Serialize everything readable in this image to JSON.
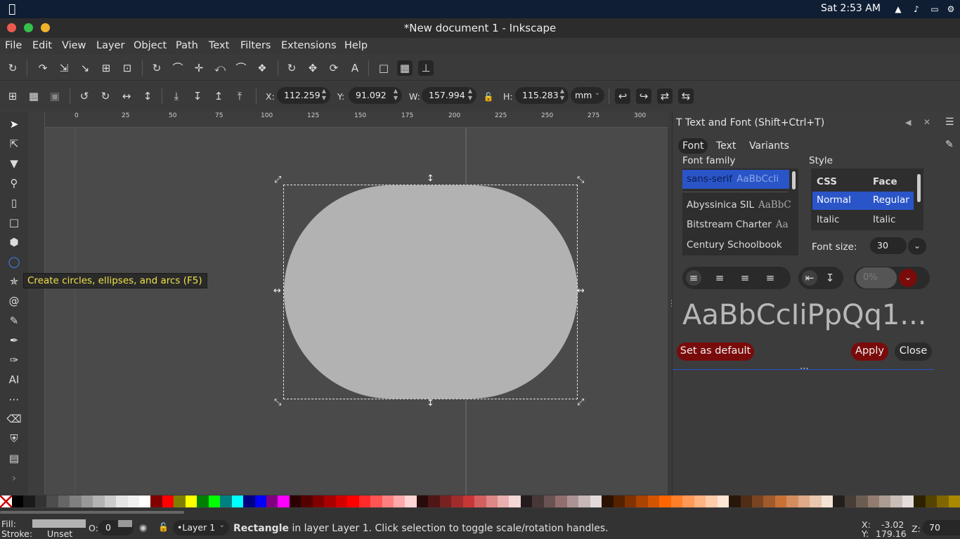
{
  "system": {
    "clock": "Sat  2:53 AM"
  },
  "window": {
    "title": "*New document 1 - Inkscape"
  },
  "menu": [
    "File",
    "Edit",
    "View",
    "Layer",
    "Object",
    "Path",
    "Text",
    "Filters",
    "Extensions",
    "Help"
  ],
  "controls": {
    "x_label": "X:",
    "x_value": "112.259",
    "y_label": "Y:",
    "y_value": "91.092",
    "w_label": "W:",
    "w_value": "157.994",
    "h_label": "H:",
    "h_value": "115.283",
    "unit": "mm"
  },
  "ruler": {
    "h_ticks": [
      "0",
      "25",
      "50",
      "75",
      "100",
      "125",
      "150",
      "175",
      "200",
      "225",
      "250",
      "275",
      "300"
    ]
  },
  "tooltip": "Create circles, ellipses, and arcs (F5)",
  "panel": {
    "title": "Text and Font (Shift+Ctrl+T)",
    "tabs": [
      "Font",
      "Text",
      "Variants"
    ],
    "font_family_label": "Font family",
    "style_label": "Style",
    "fonts": [
      {
        "name": "sans-serif",
        "preview": "AaBbCcIi"
      },
      {
        "name": "Abyssinica SIL",
        "preview": "AaBbC"
      },
      {
        "name": "Bitstream Charter",
        "preview": "Aa"
      },
      {
        "name": "Century Schoolbook",
        "preview": ""
      }
    ],
    "style_headers": {
      "css": "CSS",
      "face": "Face"
    },
    "styles": [
      {
        "css": "Normal",
        "face": "Regular"
      },
      {
        "css": "Italic",
        "face": "Italic"
      }
    ],
    "font_size_label": "Font size:",
    "font_size": "30",
    "spacing_value": "0%",
    "preview": "AaBbCcIiPpQq1...",
    "set_default": "Set as default",
    "apply": "Apply",
    "close": "Close"
  },
  "palette": [
    "#ffffff",
    "#000000",
    "#1a1a1a",
    "#333333",
    "#4d4d4d",
    "#666666",
    "#808080",
    "#999999",
    "#b3b3b3",
    "#cccccc",
    "#e6e6e6",
    "#f2f2f2",
    "#ffffff",
    "#800000",
    "#ff0000",
    "#808000",
    "#ffff00",
    "#008000",
    "#00ff00",
    "#008080",
    "#00ffff",
    "#000080",
    "#0000ff",
    "#800080",
    "#ff00ff",
    "#2b0000",
    "#550000",
    "#800000",
    "#aa0000",
    "#d40000",
    "#ff0000",
    "#ff2a2a",
    "#ff5555",
    "#ff8080",
    "#ffaaaa",
    "#ffd5d5",
    "#280b0b",
    "#501616",
    "#782121",
    "#a02c2c",
    "#c83737",
    "#d35f5f",
    "#de8787",
    "#e9afaf",
    "#f4d7d7",
    "#241c1c",
    "#483737",
    "#6c5353",
    "#916f6f",
    "#ac9393",
    "#c8b7b7",
    "#e3dbdb",
    "#2b1100",
    "#552200",
    "#803300",
    "#aa4400",
    "#d45500",
    "#ff6600",
    "#ff7f2a",
    "#ff9955",
    "#ffb380",
    "#ffccaa",
    "#ffe6d5",
    "#28170b",
    "#502d16",
    "#784421",
    "#a05a2c",
    "#c87137",
    "#d38d5f",
    "#deaa87",
    "#e9c6af",
    "#f4e3d7",
    "#241f1c",
    "#483e37",
    "#6c5d53",
    "#917c6f",
    "#ac9d93",
    "#c8beb7",
    "#e3dedb",
    "#2b2200",
    "#554400",
    "#806600",
    "#aa8800"
  ],
  "status": {
    "fill_label": "Fill:",
    "stroke_label": "Stroke:",
    "stroke_value": "Unset",
    "opacity_label": "O:",
    "opacity_value": "0",
    "layer": "•Layer 1",
    "message_bold": "Rectangle",
    "message": " in layer Layer 1. Click selection to toggle scale/rotation handles.",
    "x_label": "X:",
    "x_value": "-3.02",
    "y_label": "Y:",
    "y_value": "179.16",
    "zoom_label": "Z:",
    "zoom_value": "70"
  }
}
